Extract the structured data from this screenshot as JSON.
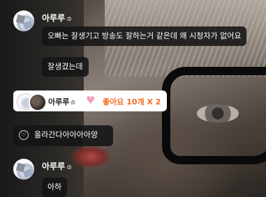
{
  "messages": [
    {
      "user": "아루루",
      "badge_icon": "crown-icon",
      "lines": [
        "오빠는 잘생기고 방송도 잘하는거 같은데 왜 시청자가 없어요",
        "잘생겼는데"
      ]
    },
    {
      "like_event": {
        "user": "아루루",
        "text": "좋아요 10개 X 2",
        "icon": "heart-icon",
        "accent": "#f26a1f"
      }
    },
    {
      "system": {
        "icon": "heart-outline-icon",
        "text": "올라간다아아아아앙"
      }
    },
    {
      "user": "아루루",
      "badge_icon": "crown-icon",
      "lines": [
        "아하"
      ]
    }
  ]
}
